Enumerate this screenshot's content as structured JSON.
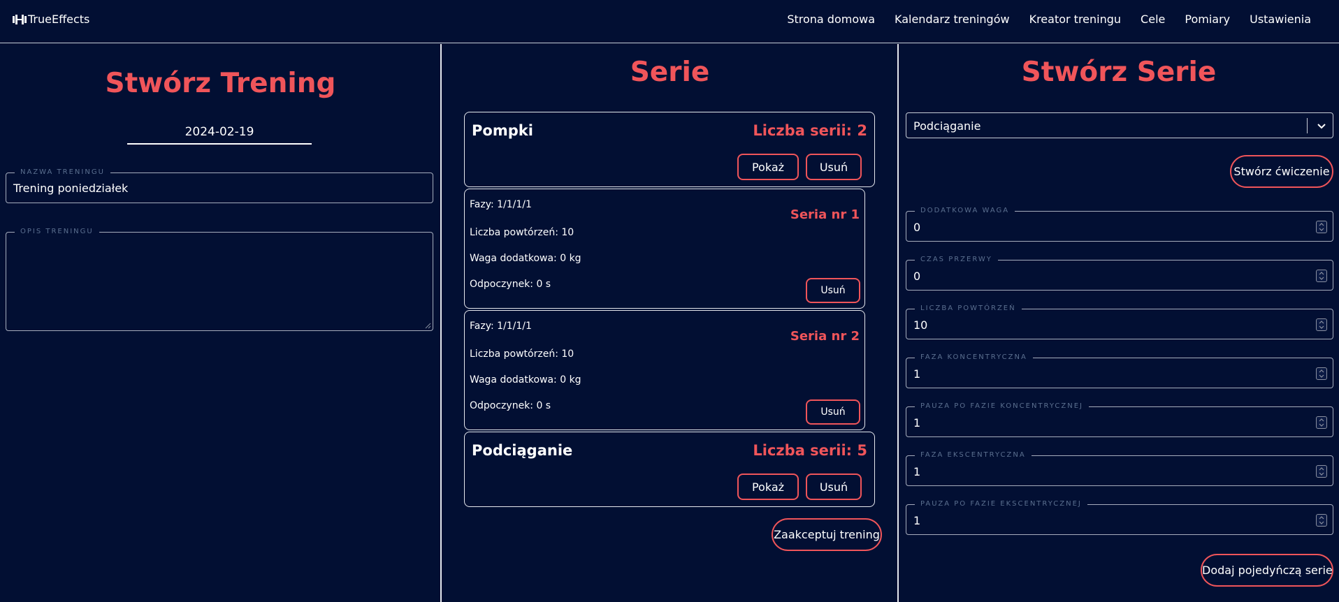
{
  "nav": {
    "brand": "TrueEffects",
    "links": [
      "Strona domowa",
      "Kalendarz treningów",
      "Kreator treningu",
      "Cele",
      "Pomiary",
      "Ustawienia"
    ]
  },
  "left": {
    "title": "Stwórz Trening",
    "date": "2024-02-19",
    "name_field": {
      "label": "NAZWA TRENINGU",
      "value": "Trening poniedziałek"
    },
    "desc_field": {
      "label": "OPIS TRENINGU",
      "value": ""
    }
  },
  "middle": {
    "title": "Serie",
    "exercises": [
      {
        "name": "Pompki",
        "count_label": "Liczba serii: 2",
        "show_label": "Pokaż",
        "delete_label": "Usuń"
      },
      {
        "name": "Podciąganie",
        "count_label": "Liczba serii: 5",
        "show_label": "Pokaż",
        "delete_label": "Usuń"
      }
    ],
    "sets": [
      {
        "phases": "Fazy: 1/1/1/1",
        "reps": "Liczba powtórzeń: 10",
        "weight": "Waga dodatkowa: 0 kg",
        "rest": "Odpoczynek: 0 s",
        "nr": "Seria nr 1",
        "delete_label": "Usuń"
      },
      {
        "phases": "Fazy: 1/1/1/1",
        "reps": "Liczba powtórzeń: 10",
        "weight": "Waga dodatkowa: 0 kg",
        "rest": "Odpoczynek: 0 s",
        "nr": "Seria nr 2",
        "delete_label": "Usuń"
      }
    ],
    "accept_label": "Zaakceptuj trening"
  },
  "right": {
    "title": "Stwórz Serie",
    "exercise_select": "Podciąganie",
    "create_exercise_label": "Stwórz ćwiczenie",
    "fields": [
      {
        "label": "DODATKOWA WAGA",
        "value": "0"
      },
      {
        "label": "CZAS PRZERWY",
        "value": "0"
      },
      {
        "label": "LICZBA POWTÓRZEŃ",
        "value": "10"
      },
      {
        "label": "FAZA KONCENTRYCZNA",
        "value": "1"
      },
      {
        "label": "PAUZA PO FAZIE KONCENTRYCZNEJ",
        "value": "1"
      },
      {
        "label": "FAZA EKSCENTRYCZNA",
        "value": "1"
      },
      {
        "label": "PAUZA PO FAZIE EKSCENTRYCZNEJ",
        "value": "1"
      }
    ],
    "add_set_label": "Dodaj pojedyńczą serie"
  },
  "colors": {
    "background": "#020f33",
    "accent": "#f0555a",
    "legend": "#5b6f8f"
  },
  "icons": {
    "brand": "dumbbell-icon",
    "select": "chevron-down-icon",
    "spinner": "spinner-arrows-icon"
  }
}
